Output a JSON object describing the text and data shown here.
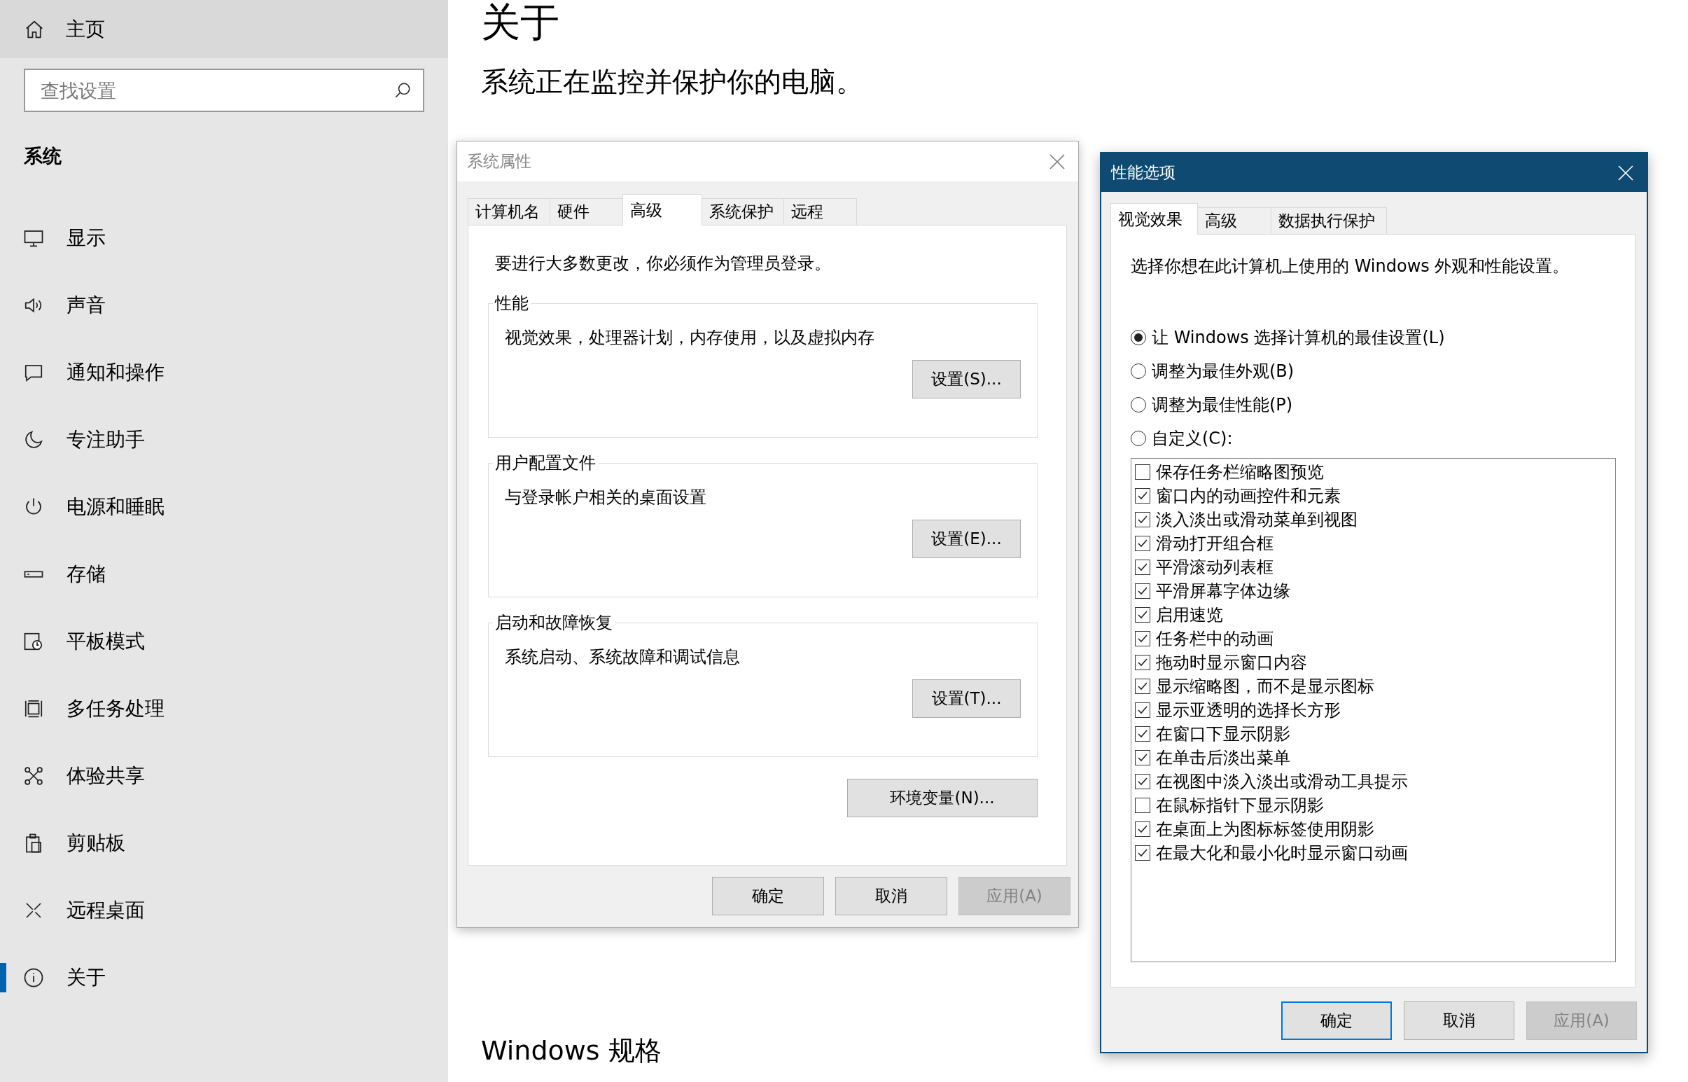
{
  "sidebar": {
    "home": "主页",
    "search": {
      "placeholder": "查找设置"
    },
    "section": "系统",
    "items": [
      {
        "label": "显示",
        "selected": false
      },
      {
        "label": "声音",
        "selected": false
      },
      {
        "label": "通知和操作",
        "selected": false
      },
      {
        "label": "专注助手",
        "selected": false
      },
      {
        "label": "电源和睡眠",
        "selected": false
      },
      {
        "label": "存储",
        "selected": false
      },
      {
        "label": "平板模式",
        "selected": false
      },
      {
        "label": "多任务处理",
        "selected": false
      },
      {
        "label": "体验共享",
        "selected": false
      },
      {
        "label": "剪贴板",
        "selected": false
      },
      {
        "label": "远程桌面",
        "selected": false
      },
      {
        "label": "关于",
        "selected": true
      }
    ]
  },
  "main": {
    "title": "关于",
    "status": "系统正在监控并保护你的电脑。",
    "specs_heading": "Windows 规格"
  },
  "system_properties": {
    "title": "系统属性",
    "tabs": [
      {
        "label": "计算机名",
        "selected": false
      },
      {
        "label": "硬件",
        "selected": false
      },
      {
        "label": "高级",
        "selected": true
      },
      {
        "label": "系统保护",
        "selected": false
      },
      {
        "label": "远程",
        "selected": false
      }
    ],
    "note": "要进行大多数更改，你必须作为管理员登录。",
    "groups": [
      {
        "title": "性能",
        "description": "视觉效果，处理器计划，内存使用，以及虚拟内存",
        "button": "设置(S)..."
      },
      {
        "title": "用户配置文件",
        "description": "与登录帐户相关的桌面设置",
        "button": "设置(E)..."
      },
      {
        "title": "启动和故障恢复",
        "description": "系统启动、系统故障和调试信息",
        "button": "设置(T)..."
      }
    ],
    "env_button": "环境变量(N)...",
    "buttons": [
      {
        "label": "确定",
        "disabled": false
      },
      {
        "label": "取消",
        "disabled": false
      },
      {
        "label": "应用(A)",
        "disabled": true
      }
    ]
  },
  "performance_options": {
    "title": "性能选项",
    "tabs": [
      {
        "label": "视觉效果",
        "selected": true
      },
      {
        "label": "高级",
        "selected": false
      },
      {
        "label": "数据执行保护",
        "selected": false
      }
    ],
    "description": "选择你想在此计算机上使用的 Windows 外观和性能设置。",
    "options": [
      {
        "label": "让 Windows 选择计算机的最佳设置(L)",
        "selected": true
      },
      {
        "label": "调整为最佳外观(B)",
        "selected": false
      },
      {
        "label": "调整为最佳性能(P)",
        "selected": false
      },
      {
        "label": "自定义(C):",
        "selected": false
      }
    ],
    "effects": [
      {
        "label": "保存任务栏缩略图预览",
        "checked": false
      },
      {
        "label": "窗口内的动画控件和元素",
        "checked": true
      },
      {
        "label": "淡入淡出或滑动菜单到视图",
        "checked": true
      },
      {
        "label": "滑动打开组合框",
        "checked": true
      },
      {
        "label": "平滑滚动列表框",
        "checked": true
      },
      {
        "label": "平滑屏幕字体边缘",
        "checked": true
      },
      {
        "label": "启用速览",
        "checked": true
      },
      {
        "label": "任务栏中的动画",
        "checked": true
      },
      {
        "label": "拖动时显示窗口内容",
        "checked": true
      },
      {
        "label": "显示缩略图，而不是显示图标",
        "checked": true
      },
      {
        "label": "显示亚透明的选择长方形",
        "checked": true
      },
      {
        "label": "在窗口下显示阴影",
        "checked": true
      },
      {
        "label": "在单击后淡出菜单",
        "checked": true
      },
      {
        "label": "在视图中淡入淡出或滑动工具提示",
        "checked": true
      },
      {
        "label": "在鼠标指针下显示阴影",
        "checked": false
      },
      {
        "label": "在桌面上为图标标签使用阴影",
        "checked": true
      },
      {
        "label": "在最大化和最小化时显示窗口动画",
        "checked": true
      }
    ],
    "buttons": [
      {
        "label": "确定",
        "disabled": false,
        "focused": true
      },
      {
        "label": "取消",
        "disabled": false,
        "focused": false
      },
      {
        "label": "应用(A)",
        "disabled": true,
        "focused": false
      }
    ]
  }
}
